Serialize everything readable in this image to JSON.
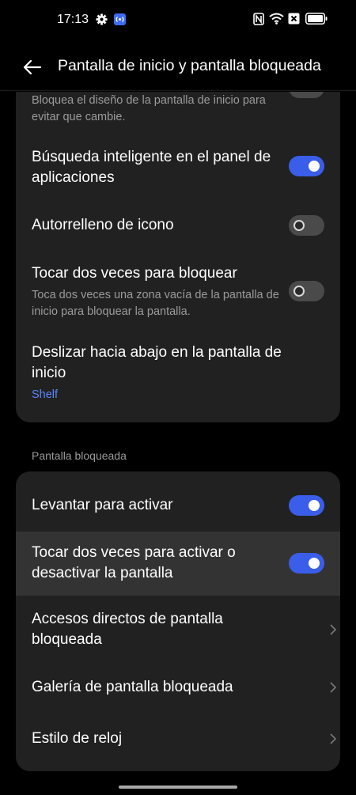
{
  "status_bar": {
    "time": "17:13",
    "icons_left": [
      "gear-icon",
      "nfc-badge-icon"
    ],
    "icons_right": [
      "nfc-icon",
      "wifi-icon",
      "sim-blocked-icon",
      "battery-icon"
    ],
    "accent": "#3f6bf0"
  },
  "header": {
    "title": "Pantalla de inicio y pantalla bloqueada"
  },
  "home_section": {
    "items": [
      {
        "subtitle": "Bloquea el diseño de la pantalla de inicio para evitar que cambie.",
        "control": "toggle"
      },
      {
        "title": "Búsqueda inteligente en el panel de aplicaciones",
        "control": "toggle",
        "enabled": true
      },
      {
        "title": "Autorrelleno de icono",
        "control": "toggle",
        "enabled": false
      },
      {
        "title": "Tocar dos veces para bloquear",
        "subtitle": "Toca dos veces una zona vacía de la pantalla de inicio para bloquear la pantalla.",
        "control": "toggle",
        "enabled": false
      },
      {
        "title": "Deslizar hacia abajo en la pantalla de inicio",
        "value": "Shelf",
        "control": "link"
      }
    ]
  },
  "lock_section": {
    "label": "Pantalla bloqueada",
    "items": [
      {
        "title": "Levantar para activar",
        "control": "toggle",
        "enabled": true
      },
      {
        "title": "Tocar dos veces para activar o desactivar la pantalla",
        "control": "toggle",
        "enabled": true,
        "highlighted": true
      },
      {
        "title": "Accesos directos de pantalla bloqueada",
        "control": "chevron"
      },
      {
        "title": "Galería de pantalla bloqueada",
        "control": "chevron"
      },
      {
        "title": "Estilo de reloj",
        "control": "chevron"
      }
    ]
  },
  "colors": {
    "background": "#000000",
    "card": "#212121",
    "toggle_on": "#3a5ee9",
    "toggle_off": "#4a4a4a",
    "link": "#5a86ff",
    "secondary_text": "#9b9b9b"
  }
}
